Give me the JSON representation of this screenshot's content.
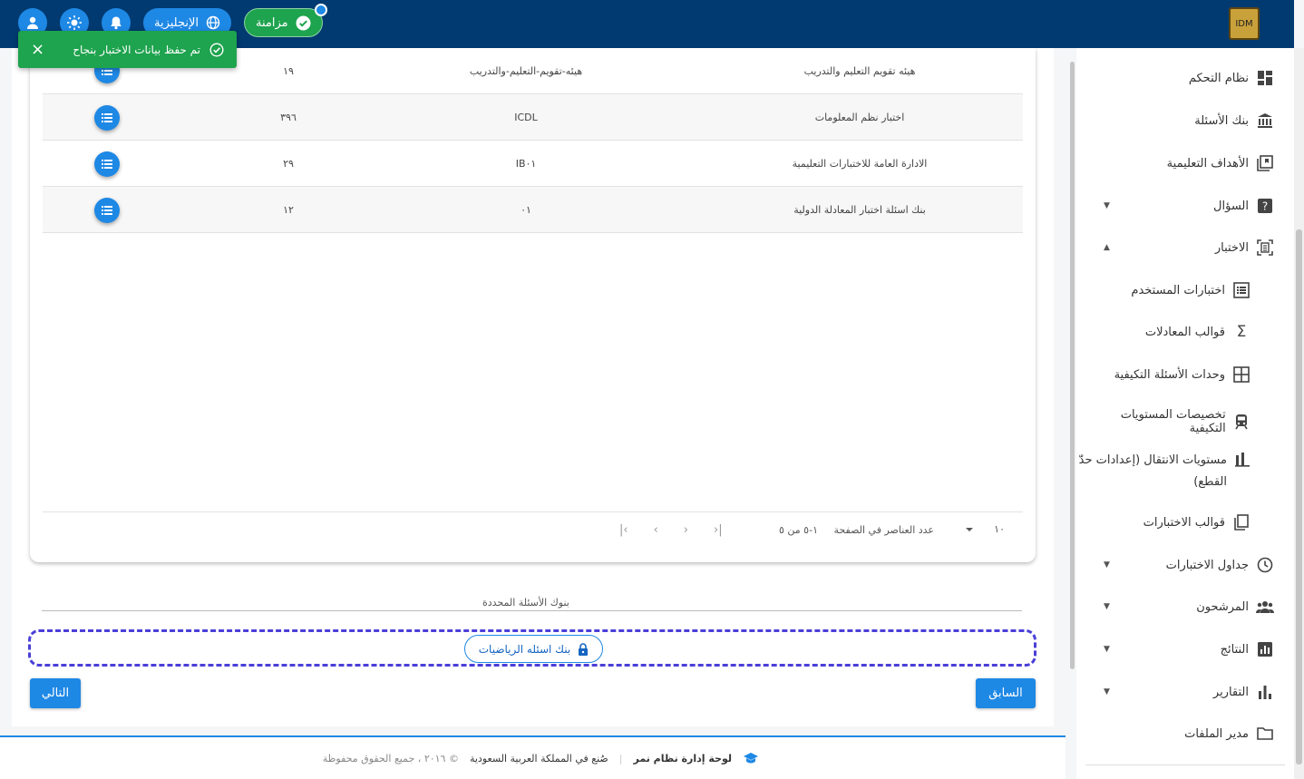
{
  "header": {
    "sync_label": "مزامنة",
    "lang_label": "الإنجليزية",
    "logo_text": "IDM"
  },
  "toast": {
    "message": "تم حفظ بيانات الاختبار بنجاح",
    "close": "×"
  },
  "table": {
    "rows": [
      {
        "name": "هيئه تقويم التعليم والتدريب",
        "code": "هيئه-تقويم-التعليم-والتدريب",
        "count": "١٩"
      },
      {
        "name": "اختبار نظم المعلومات",
        "code": "ICDL",
        "count": "٣٩٦"
      },
      {
        "name": "الادارة العامة للاختبارات التعليمية",
        "code": "IB٠١",
        "count": "٢٩"
      },
      {
        "name": "بنك اسئلة اختبار المعادلة الدولية",
        "code": "٠١",
        "count": "١٢"
      }
    ]
  },
  "pager": {
    "page_size": "١٠",
    "page_size_label": "عدد العناصر في الصفحة",
    "range": "١-٥ من ٥",
    "first": "|‹",
    "prev": "‹",
    "next": "›",
    "last": "›|"
  },
  "selected": {
    "title": "بنوك الأسئلة المحددة",
    "chip": "بنك اسئله الرياضيات"
  },
  "buttons": {
    "prev": "السابق",
    "next": "التالي"
  },
  "footer": {
    "brand": "لوحة إدارة نظام نمر",
    "made_in": "صُنع في المملكة العربية السعودية",
    "copyright": "© ٢٠١٦ ، جميع الحقوق محفوظة"
  },
  "sidebar": {
    "items": [
      {
        "label": "نظام التحكم",
        "icon": "dashboard-icon"
      },
      {
        "label": "بنك الأسئلة",
        "icon": "bank-icon"
      },
      {
        "label": "الأهداف التعليمية",
        "icon": "objectives-icon"
      },
      {
        "label": "السؤال",
        "icon": "question-icon",
        "caret": "▼"
      },
      {
        "label": "الاختبار",
        "icon": "exam-icon",
        "caret": "▲"
      },
      {
        "label": "اختبارات المستخدم",
        "icon": "list-icon"
      },
      {
        "label": "قوالب المعادلات",
        "icon": "sigma-icon"
      },
      {
        "label": "وحدات الأسئلة التكيفية",
        "icon": "grid-icon"
      },
      {
        "label": "تخصيصات المستويات التكيفية",
        "icon": "train-icon"
      },
      {
        "label": "مستويات الانتقال (إعدادات حدّ",
        "label2": "القطع)",
        "icon": "bar-icon"
      },
      {
        "label": "قوالب الاختبارات",
        "icon": "copy-icon"
      },
      {
        "label": "جداول الاختبارات",
        "icon": "clock-icon",
        "caret": "▼"
      },
      {
        "label": "المرشحون",
        "icon": "people-icon",
        "caret": "▼"
      },
      {
        "label": "النتائج",
        "icon": "results-icon",
        "caret": "▼"
      },
      {
        "label": "التقارير",
        "icon": "reports-icon",
        "caret": "▼"
      },
      {
        "label": "مدير الملفات",
        "icon": "folder-icon"
      }
    ]
  }
}
